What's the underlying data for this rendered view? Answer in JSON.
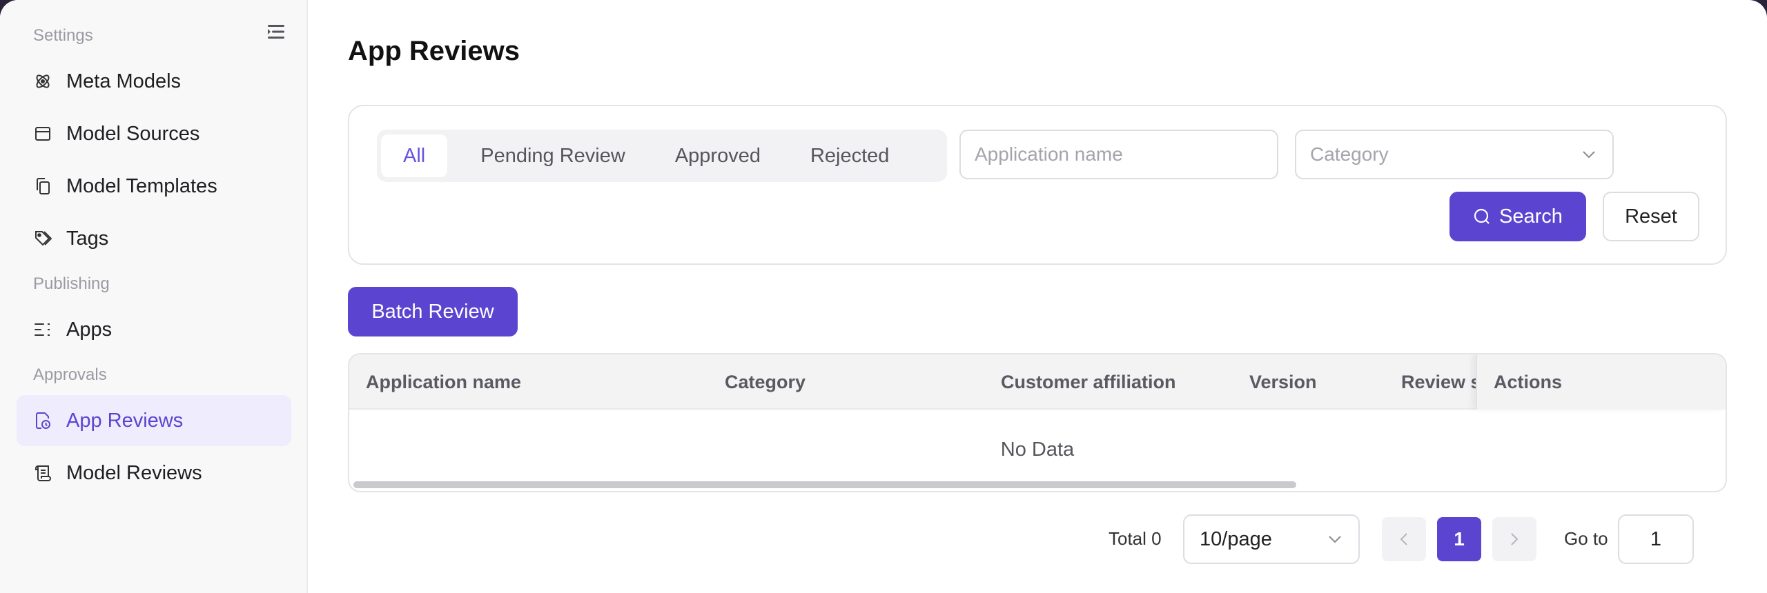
{
  "sidebar": {
    "sections": [
      "Settings",
      "Publishing",
      "Approvals"
    ],
    "items": [
      {
        "label": "Meta Models",
        "icon": "atom-icon"
      },
      {
        "label": "Model Sources",
        "icon": "window-icon"
      },
      {
        "label": "Model Templates",
        "icon": "copy-icon"
      },
      {
        "label": "Tags",
        "icon": "tags-icon"
      },
      {
        "label": "Apps",
        "icon": "list-icon"
      },
      {
        "label": "App Reviews",
        "icon": "review-clock-icon",
        "active": true
      },
      {
        "label": "Model Reviews",
        "icon": "scroll-icon"
      }
    ]
  },
  "page": {
    "title": "App Reviews"
  },
  "filters": {
    "tabs": [
      "All",
      "Pending Review",
      "Approved",
      "Rejected"
    ],
    "active_tab": "All",
    "app_name_placeholder": "Application name",
    "category_placeholder": "Category",
    "search_label": "Search",
    "reset_label": "Reset"
  },
  "batch_review_label": "Batch Review",
  "table": {
    "columns": [
      "Application name",
      "Category",
      "Customer affiliation",
      "Version",
      "Review s",
      "Actions"
    ],
    "empty_text": "No Data"
  },
  "pagination": {
    "total_label": "Total 0",
    "page_size": "10/page",
    "current_page": "1",
    "goto_label": "Go to",
    "goto_value": "1"
  },
  "colors": {
    "accent": "#5b45d0",
    "active_bg": "#efecfd"
  }
}
